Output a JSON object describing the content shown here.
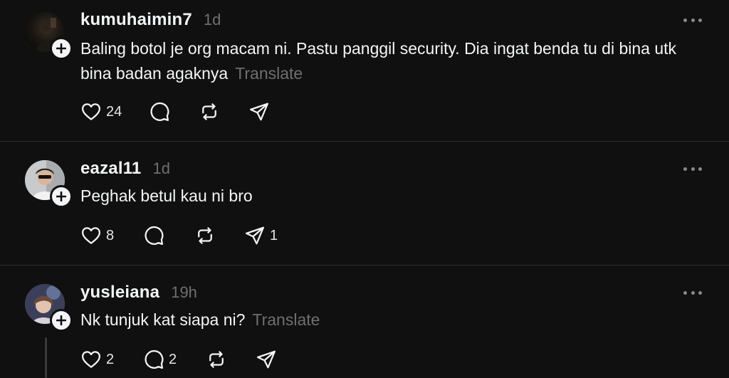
{
  "posts": [
    {
      "username": "kumuhaimin7",
      "time": "1d",
      "text": "Baling botol je org macam ni. Pastu panggil security. Dia ingat benda tu di bina utk bina badan agaknya",
      "translate": "Translate",
      "likes": "24",
      "comments": "",
      "reposts": "",
      "shares": ""
    },
    {
      "username": "eazal11",
      "time": "1d",
      "text": "Peghak betul kau ni bro",
      "translate": "",
      "likes": "8",
      "comments": "",
      "reposts": "",
      "shares": "1"
    },
    {
      "username": "yusleiana",
      "time": "19h",
      "text": "Nk tunjuk kat siapa ni?",
      "translate": "Translate",
      "likes": "2",
      "comments": "2",
      "reposts": "",
      "shares": ""
    }
  ],
  "colors": {
    "background": "#101010",
    "text": "#f3f5f7",
    "muted": "#6f6f6f",
    "divider": "#2d2d2d"
  },
  "icons": [
    "plus-icon",
    "more-icon",
    "heart-icon",
    "comment-icon",
    "repost-icon",
    "share-icon"
  ]
}
